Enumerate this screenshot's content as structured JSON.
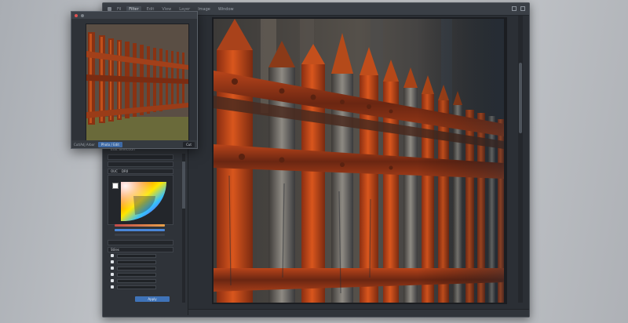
{
  "app": {
    "tabs": [
      "",
      "Fil",
      "Filter",
      "Edit",
      "View",
      "Layer",
      "Image",
      "Window"
    ],
    "active_tab_index": 2
  },
  "preview": {
    "title": "",
    "footer_label": "Cut/Adj Arbor",
    "primary_button": "Photo / Edit",
    "secondary_button": "Cut"
  },
  "panel": {
    "header": "Edit Selection",
    "field1": "",
    "field2_a": "OUC",
    "field2_b": "DR0",
    "section_label": "Stiles",
    "ok_label": "Apply"
  },
  "colors": {
    "accent": "#3f73b8",
    "close": "#e05252",
    "app_bg": "#2b2f35"
  }
}
